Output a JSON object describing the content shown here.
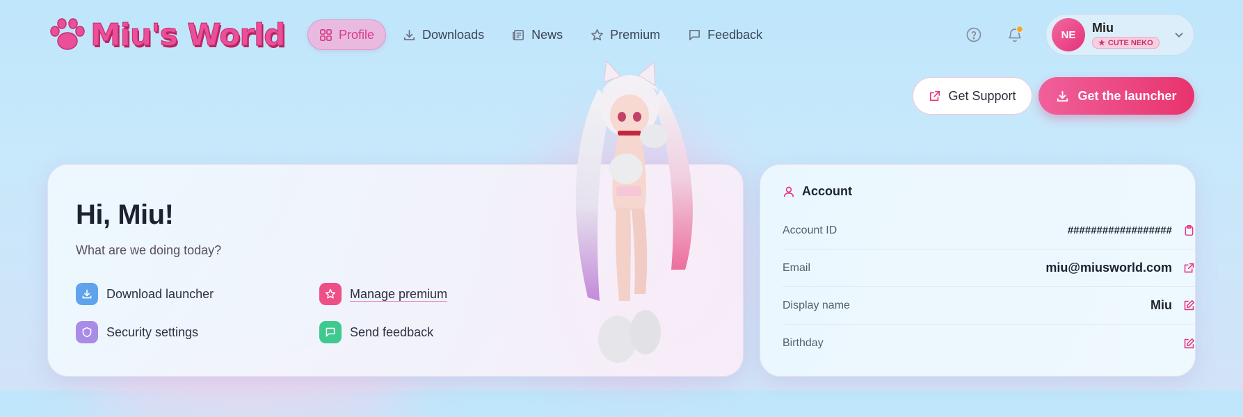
{
  "app": {
    "logo_text": "Miu's World"
  },
  "nav": {
    "items": [
      {
        "label": "Profile",
        "icon": "grid-icon",
        "active": true
      },
      {
        "label": "Downloads",
        "icon": "download-icon"
      },
      {
        "label": "News",
        "icon": "newspaper-icon"
      },
      {
        "label": "Premium",
        "icon": "star-icon"
      },
      {
        "label": "Feedback",
        "icon": "message-icon"
      }
    ]
  },
  "header": {
    "help_icon": "help-circle-icon",
    "notification_icon": "bell-icon",
    "user": {
      "initials": "NE",
      "name": "Miu",
      "tag": "CUTE NEKO"
    }
  },
  "actions": {
    "support_label": "Get Support",
    "launcher_label": "Get the launcher"
  },
  "welcome": {
    "greeting": "Hi, Miu!",
    "subtitle": "What are we doing today?",
    "quick_links": [
      {
        "label": "Download launcher",
        "icon": "download-icon",
        "color": "#5ea3ec"
      },
      {
        "label": "Manage premium",
        "icon": "star-icon",
        "color": "#ee4f86"
      },
      {
        "label": "Security settings",
        "icon": "shield-icon",
        "color": "#a88ce8"
      },
      {
        "label": "Send feedback",
        "icon": "message-icon",
        "color": "#3ec98f"
      }
    ]
  },
  "account": {
    "title": "Account",
    "rows": [
      {
        "label": "Account ID",
        "value": "##################",
        "action_icon": "clipboard-icon"
      },
      {
        "label": "Email",
        "value": "miu@miusworld.com",
        "action_icon": "external-link-icon"
      },
      {
        "label": "Display name",
        "value": "Miu",
        "action_icon": "edit-icon"
      },
      {
        "label": "Birthday",
        "value": "",
        "action_icon": "edit-icon"
      }
    ]
  },
  "colors": {
    "accent": "#e6337a",
    "accent_light": "#f0609b",
    "background": "#c4e6fb"
  }
}
